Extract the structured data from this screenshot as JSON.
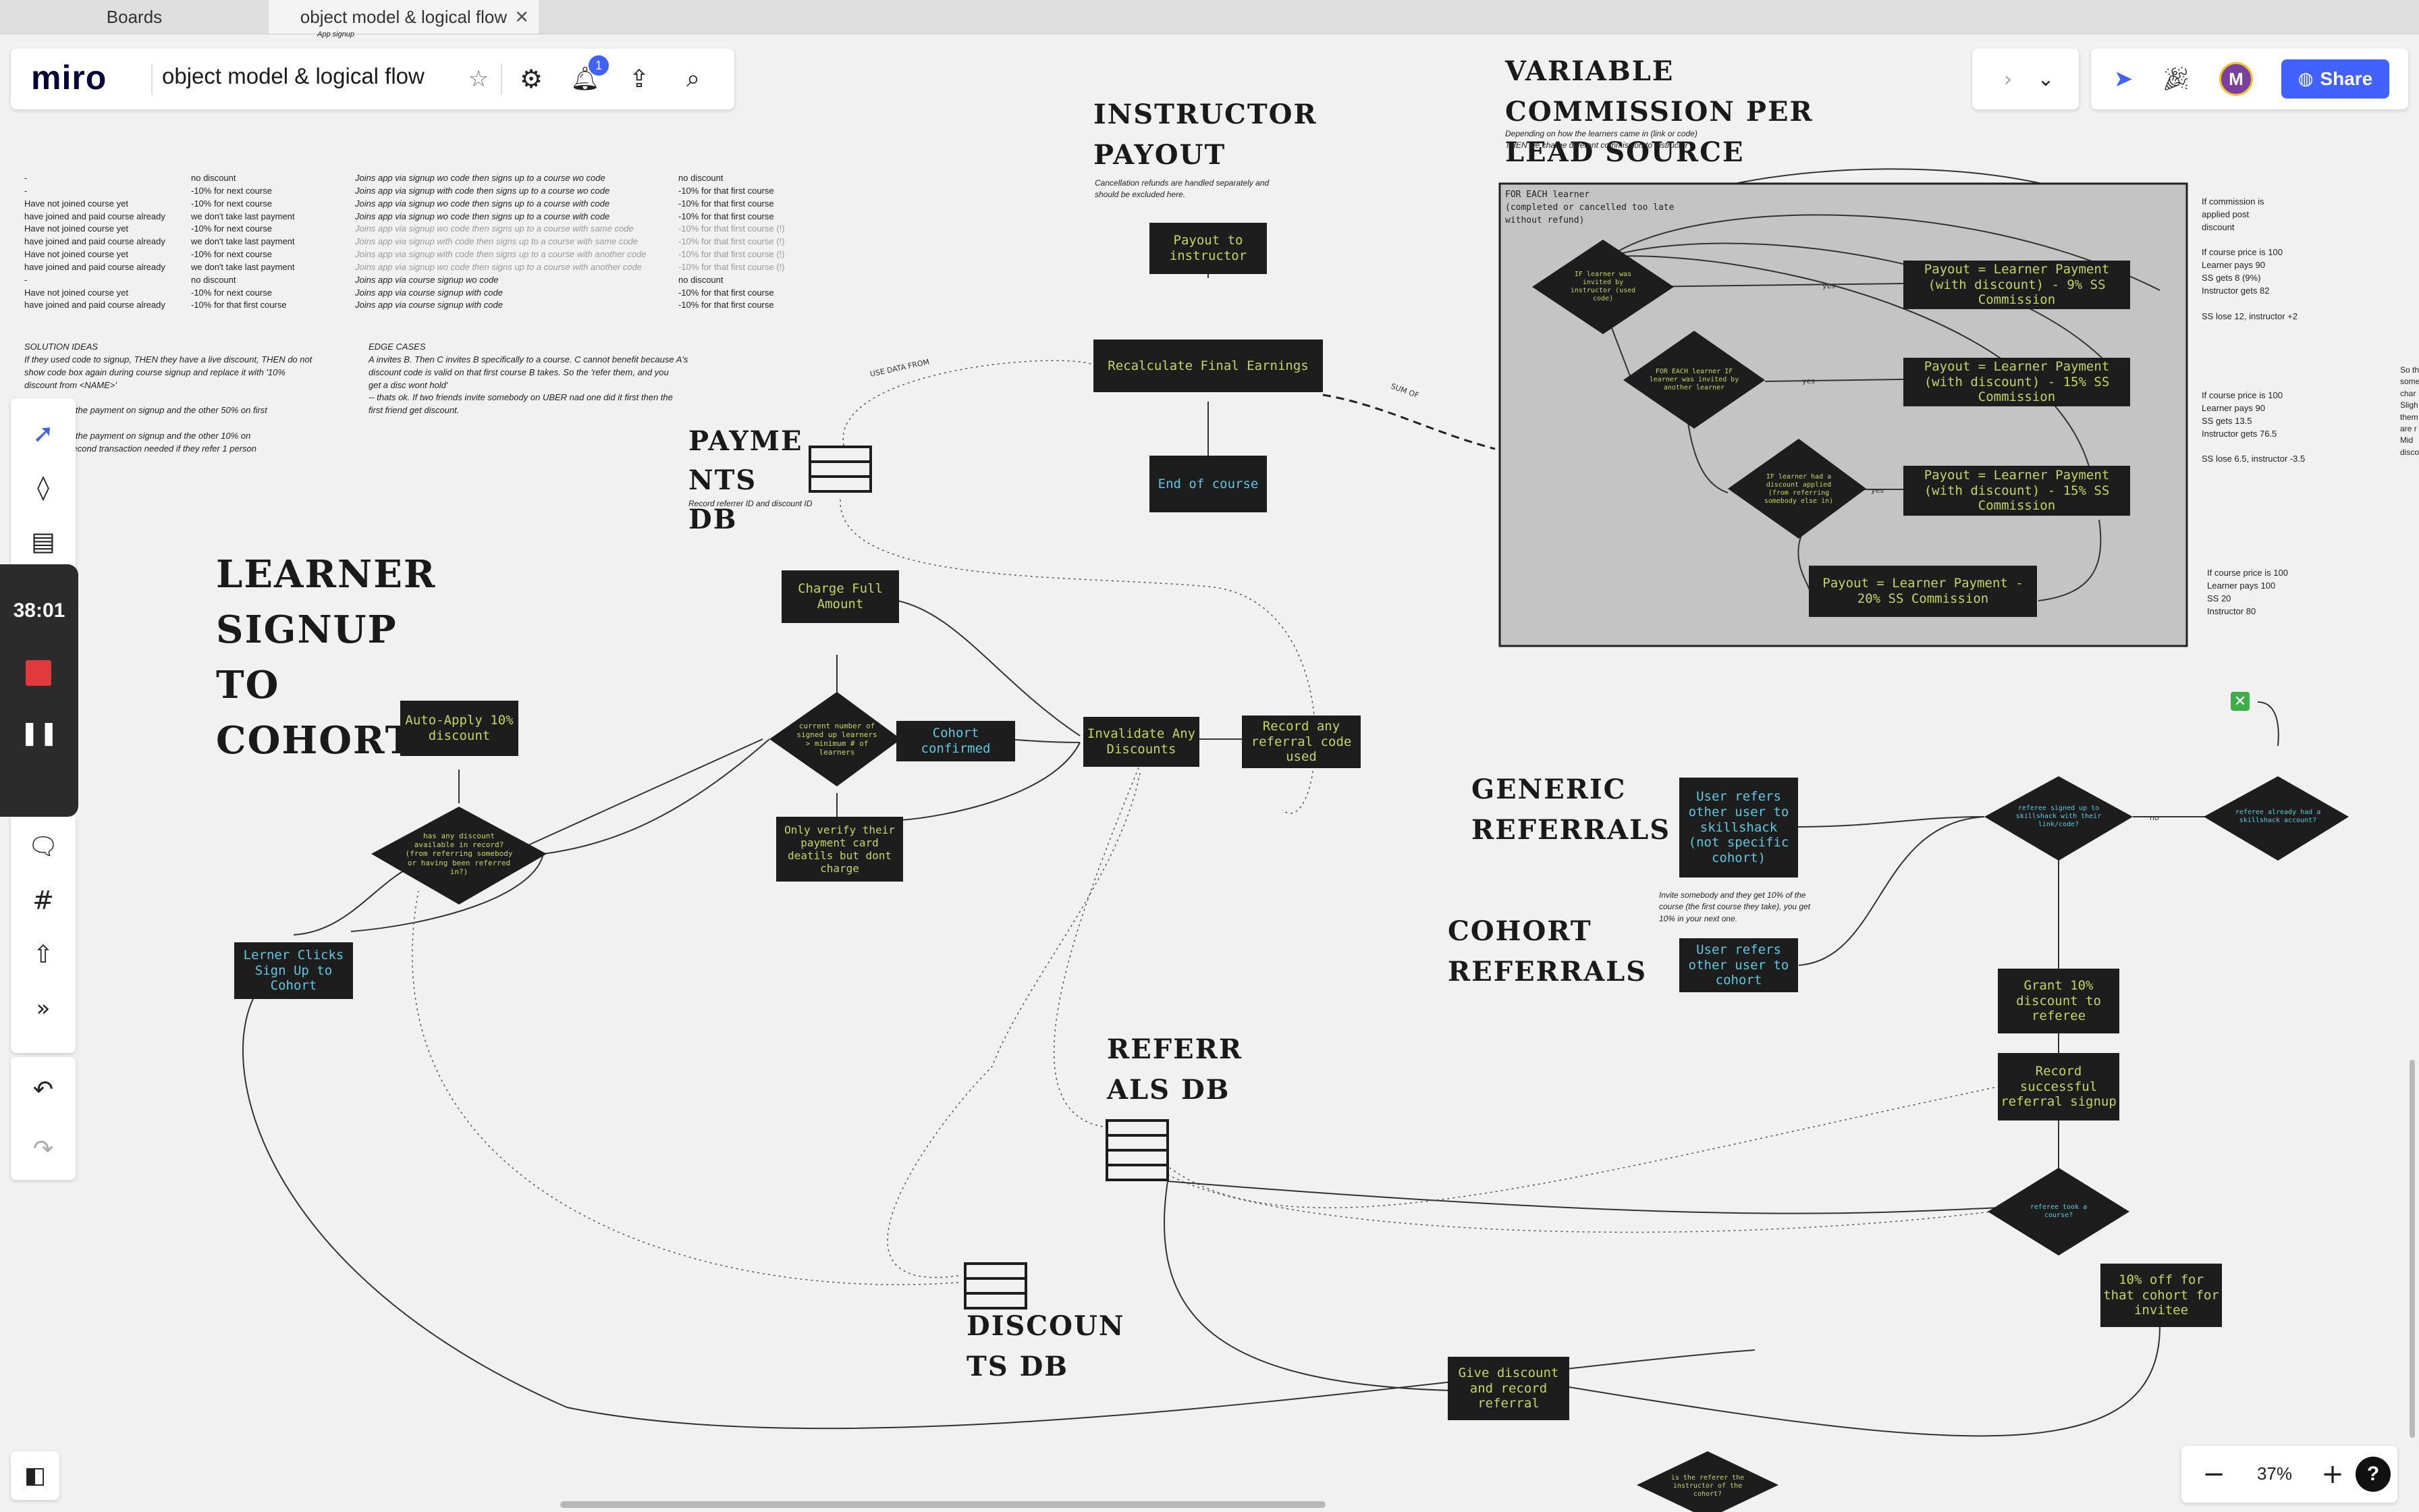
{
  "tabs": [
    {
      "label": "Boards"
    },
    {
      "label": "object model & logical flow"
    }
  ],
  "header": {
    "logo": "miro",
    "board_title": "object model & logical flow",
    "notification_count": "1",
    "share_label": "Share",
    "avatar_initial": "M",
    "breadcrumb_note": "App signup"
  },
  "sidebar": {
    "timer": "38:01"
  },
  "zoom": {
    "level": "37%"
  },
  "board": {
    "headings": {
      "learner_signup": "LEARNER SIGNUP TO COHORT",
      "instructor_payout": "INSTRUCTOR PAYOUT",
      "variable_commission": "VARIABLE COMMISSION PER LEAD SOURCE",
      "payments_db": "PAYME NTS DB",
      "generic_referrals": "GENERIC REFERRALS",
      "cohort_referrals": "COHORT REFERRALS",
      "referrals_db": "REFERR ALS DB",
      "discounts_db": "DISCOUN TS DB"
    },
    "notes": {
      "instructor_payout_note": "Cancellation refunds are handled separately and\nshould be excluded here.",
      "variable_commission_note": "Depending on how the learners came in (link or code)\nTHEN we charge different commission to instructor",
      "for_each_learner": "FOR EACH learner\n(completed or cancelled too late\nwithout refund)",
      "payments_db_note": "Record referrer ID and discount ID",
      "generic_referral_note": "Invite somebody and they get 10% of the\ncourse (the first course they take), you get\n10% in your next one.",
      "use_data_from": "USE DATA FROM",
      "sum_of": "SUM OF",
      "solution_ideas": "SOLUTION IDEAS\nIf they used code to signup, THEN they have a live discount, THEN do not\nshow code box again during course signup and replace it with '10%\ndiscount from <NAME>'\n\nhave 50% of the payment on signup and the other 50% on first\n\nhave 90% of the payment on signup and the other 10% on\nn day? (no second transaction needed if they refer 1 person",
      "edge_cases": "EDGE CASES\nA invites B. Then C invites B specifically to a course. C cannot benefit because A's\ndiscount code is valid on that first course B takes. So the 'refer them, and you\nget a disc wont hold'\n-- thats ok. If two friends invite somebody on UBER nad one did it first then the\nfirst friend get discount.",
      "commission_side_1": "If commission is\napplied post\ndiscount\n\nIf course price is 100\nLearner pays 90\nSS gets 8 (9%)\nInstructor gets 82\n\nSS lose 12, instructor +2",
      "commission_side_2": "If course price is 100\nLearner pays 90\nSS gets 13.5\nInstructor gets 76.5\n\nSS lose 6.5, instructor -3.5",
      "commission_side_3": "If course price is 100\nLearner pays 100\nSS 20\nInstructor 80",
      "edge_text": "So th\nsome\nchar\nSligh\nthem\nare r\nMid\ndisco"
    },
    "table": {
      "col1": [
        "-",
        "-",
        "Have not joined course yet",
        "have joined and paid course already",
        "Have not joined course yet",
        "have joined and paid course already",
        "Have not joined course yet",
        "have joined and paid course already",
        "-",
        "Have not joined course yet",
        "have joined and paid course already"
      ],
      "col2": [
        "no discount",
        "-10% for next course",
        "-10% for next course",
        "we don't take last payment",
        "-10% for next course",
        "we don't take last payment",
        "-10% for next course",
        "we don't take last payment",
        "no discount",
        "-10% for next course",
        "-10% for that first course"
      ],
      "col3": [
        "Joins app via signup wo code then signs up to a course wo code",
        "Joins app via signup with code then signs up to a course wo code",
        "Joins app via signup wo code then signs up to a course with code",
        "Joins app via signup wo code then signs up to a course with code",
        "Joins app via signup wo code then signs up to a course with same code",
        "Joins app via signup with code then signs up to a course with same code",
        "Joins app via signup with code then signs up to a course with another code",
        "Joins app via signup wo code then signs up to a course with another code",
        "Joins app via course signup wo code",
        "Joins app via course signup with code",
        "Joins app via course signup with code"
      ],
      "col4": [
        "no discount",
        "-10% for that first course",
        "-10% for that first course",
        "-10% for that first course",
        "-10% for that first course (!)",
        "-10% for that first course (!)",
        "-10% for that first course (!)",
        "-10% for that first course (!)",
        "no discount",
        "-10% for that first course",
        "-10% for that first course"
      ]
    },
    "boxes": {
      "auto_apply": "Auto-Apply 10% discount",
      "charge_full": "Charge Full Amount",
      "cohort_confirmed": "Cohort confirmed",
      "only_verify": "Only verify their payment card deatils but dont charge",
      "invalidate": "Invalidate Any Discounts",
      "record_referral_code": "Record any referral code used",
      "lerner_clicks": "Lerner Clicks Sign Up to Cohort",
      "payout_instructor": "Payout to instructor",
      "recalculate": "Recalculate Final Earnings",
      "end_of_course": "End of course",
      "payout_9": "Payout = Learner Payment (with discount) - 9% SS Commission",
      "payout_15a": "Payout = Learner Payment (with discount) - 15% SS Commission",
      "payout_15b": "Payout = Learner Payment (with discount) - 15% SS Commission",
      "payout_20": "Payout = Learner Payment - 20% SS Commission",
      "user_refers_generic": "User refers other user to skillshack (not specific cohort)",
      "user_refers_cohort": "User refers other user to cohort",
      "grant_10": "Grant 10% discount to referee",
      "record_successful": "Record successful referral signup",
      "ten_off": "10% off for that cohort for invitee",
      "give_discount": "Give discount and record referral"
    },
    "diamonds": {
      "current_number": "current number of signed up learners > minimum # of learners",
      "has_discount": "has any discount available in record? (from referring somebody or having been referred in?)",
      "invited_by_instructor": "IF learner was invited by instructor (used code)",
      "invited_by_another": "FOR EACH learner IF learner was invited by another learner",
      "discount_applied": "IF learner had a discount applied (from referring somebody else in)",
      "referee_signed_up": "referee signed up to skillshack with their link/code?",
      "referee_already": "referee already had a skillshack account?",
      "referee_took": "referee took a course?",
      "is_referer": "is the referer the instructor of the cohort?"
    },
    "arrow_labels": {
      "yes": "yes",
      "no": "no",
      "false": "false",
      "true": "true"
    }
  }
}
